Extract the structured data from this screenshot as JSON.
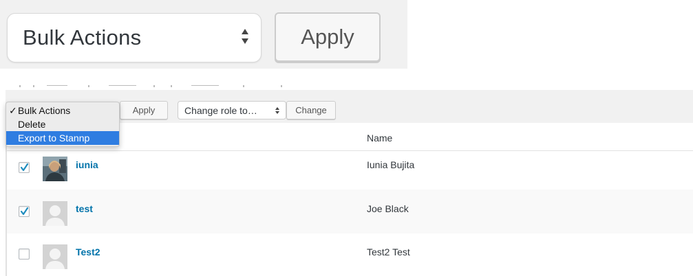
{
  "zoom": {
    "bulk_actions_label": "Bulk Actions",
    "apply_label": "Apply"
  },
  "toolbar": {
    "apply_label": "Apply",
    "role_select_label": "Change role to…",
    "change_label": "Change"
  },
  "bulk_menu": {
    "items": [
      {
        "label": "Bulk Actions",
        "checked": true
      },
      {
        "label": "Delete",
        "checked": false
      },
      {
        "label": "Export to Stannp",
        "checked": false,
        "highlighted": true
      }
    ],
    "highlight_color": "#2f7de1"
  },
  "table": {
    "name_header": "Name",
    "rows": [
      {
        "username": "iunia",
        "name": "Iunia Bujita",
        "checked": true,
        "avatar": "photo"
      },
      {
        "username": "test",
        "name": "Joe Black",
        "checked": true,
        "avatar": "default"
      },
      {
        "username": "Test2",
        "name": "Test2 Test",
        "checked": false,
        "avatar": "default"
      }
    ]
  },
  "colors": {
    "link": "#0073aa",
    "toolbar_bg": "#f1f1f1",
    "text": "#32373c"
  }
}
